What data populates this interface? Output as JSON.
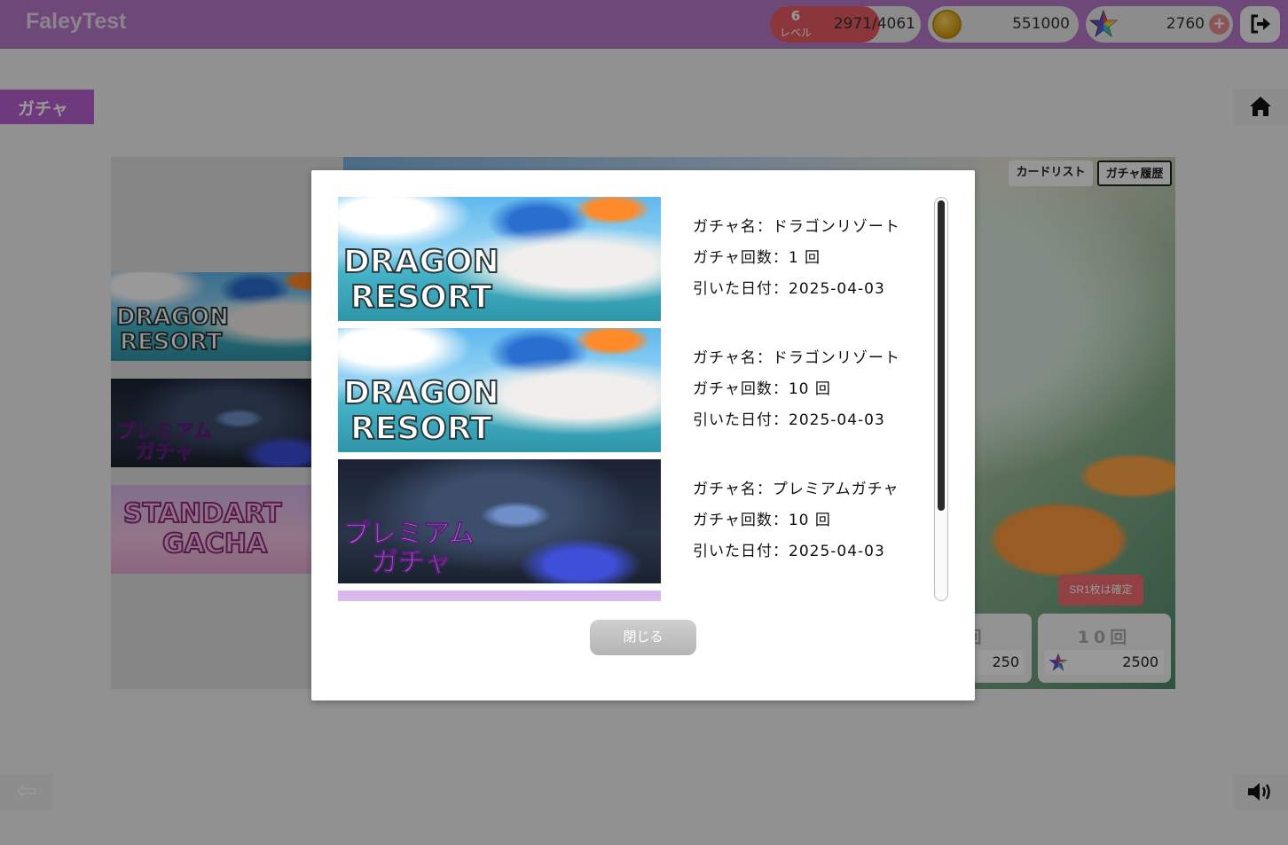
{
  "header": {
    "app_title": "FaleyTest",
    "level_number": "6",
    "level_label": "レベル",
    "xp": "2971/4061",
    "xp_progress": 0.73,
    "coins": "551000",
    "stars": "2760",
    "plus": "+"
  },
  "page": {
    "title": "ガチャ",
    "back_arrow": "⇦"
  },
  "banners": [
    {
      "name": "dragon-resort",
      "line1": "DRAGON",
      "line2": "RESORT"
    },
    {
      "name": "premium",
      "line1": "プレミアム",
      "line2": "ガチャ"
    },
    {
      "name": "standard",
      "line1": "STANDART",
      "line2": "GACHA"
    }
  ],
  "featured": {
    "tab_cardlist": "カードリスト",
    "tab_history": "ガチャ履歴",
    "sr_badge": "SR1枚は確定",
    "pull1_label": "1回",
    "pull1_cost": "250",
    "pull10_label": "10回",
    "pull10_cost": "2500"
  },
  "modal": {
    "close_label": "閉じる",
    "history": [
      {
        "name": "ガチャ名：ドラゴンリゾート",
        "count": "ガチャ回数：1 回",
        "date": "引いた日付：2025-04-03",
        "banner_line1": "DRAGON",
        "banner_line2": "RESORT"
      },
      {
        "name": "ガチャ名：ドラゴンリゾート",
        "count": "ガチャ回数：10 回",
        "date": "引いた日付：2025-04-03",
        "banner_line1": "DRAGON",
        "banner_line2": "RESORT"
      },
      {
        "name": "ガチャ名：プレミアムガチャ",
        "count": "ガチャ回数：10 回",
        "date": "引いた日付：2025-04-03",
        "banner_line1": "プレミアム",
        "banner_line2": "ガチャ"
      }
    ]
  },
  "colors": {
    "header": "#b978cc",
    "accent": "#b95fd3",
    "level_bar": "#e65a62"
  }
}
